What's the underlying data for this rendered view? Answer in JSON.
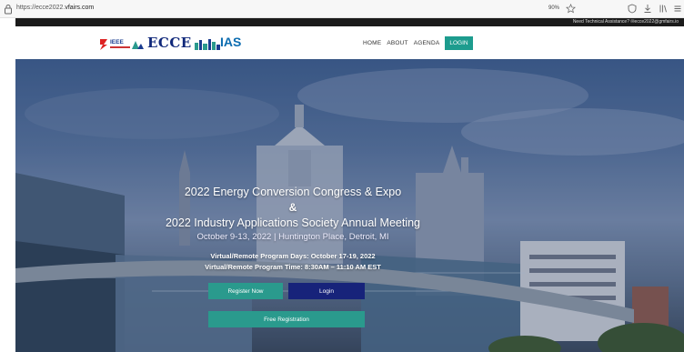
{
  "browser": {
    "url_prefix": "https://ecce2022.",
    "url_domain": "vfairs.com",
    "zoom": "90%"
  },
  "contact": {
    "text": "Need Technical Assistance? ✉ecce2022@gmfairs.io"
  },
  "header": {
    "logos": [
      "IEEE",
      "ECCE",
      "IAS"
    ],
    "nav": [
      {
        "label": "HOME"
      },
      {
        "label": "ABOUT"
      },
      {
        "label": "AGENDA"
      },
      {
        "label": "LOGIN"
      }
    ]
  },
  "hero": {
    "title1": "2022 Energy Conversion Congress & Expo",
    "amp": "&",
    "title2": "2022 Industry Applications Society Annual Meeting",
    "dates": "October 9-13, 2022 | Huntington Place, Detroit, MI",
    "virtual_days": "Virtual/Remote Program Days: October 17-19, 2022",
    "virtual_time": "Virtual/Remote Program Time: 8:30AM – 11:10 AM EST",
    "buttons": {
      "register": "Register Now",
      "login": "Login",
      "free": "Free Registration"
    }
  },
  "colors": {
    "accent": "#2a9a8d",
    "login_button": "#17237a",
    "strip": "#1b1b1b"
  }
}
